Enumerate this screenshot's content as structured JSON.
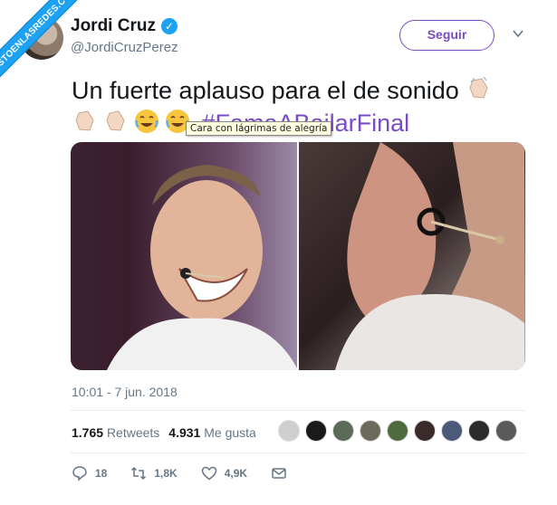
{
  "watermark": "VISTOENLASREDES.COM",
  "user": {
    "display_name": "Jordi Cruz",
    "handle": "@JordiCruzPerez"
  },
  "follow_button": "Seguir",
  "tweet": {
    "text_main": "Un fuerte aplauso para el de sonido",
    "hashtag": "#FamaABailarFinal",
    "emojis": [
      "clapping-hands",
      "clapping-hands",
      "clapping-hands",
      "face-with-tears-of-joy",
      "face-with-tears-of-joy"
    ]
  },
  "tooltip": "Cara con lágrimas de alegría",
  "timestamp": "10:01 - 7 jun. 2018",
  "stats": {
    "retweets_count": "1.765",
    "retweets_label": "Retweets",
    "likes_count": "4.931",
    "likes_label": "Me gusta"
  },
  "actions": {
    "replies": "18",
    "retweets": "1,8K",
    "likes": "4,9K"
  },
  "colors": {
    "accent": "#794bc4",
    "secondary_text": "#657786",
    "verified": "#1da1f2"
  }
}
